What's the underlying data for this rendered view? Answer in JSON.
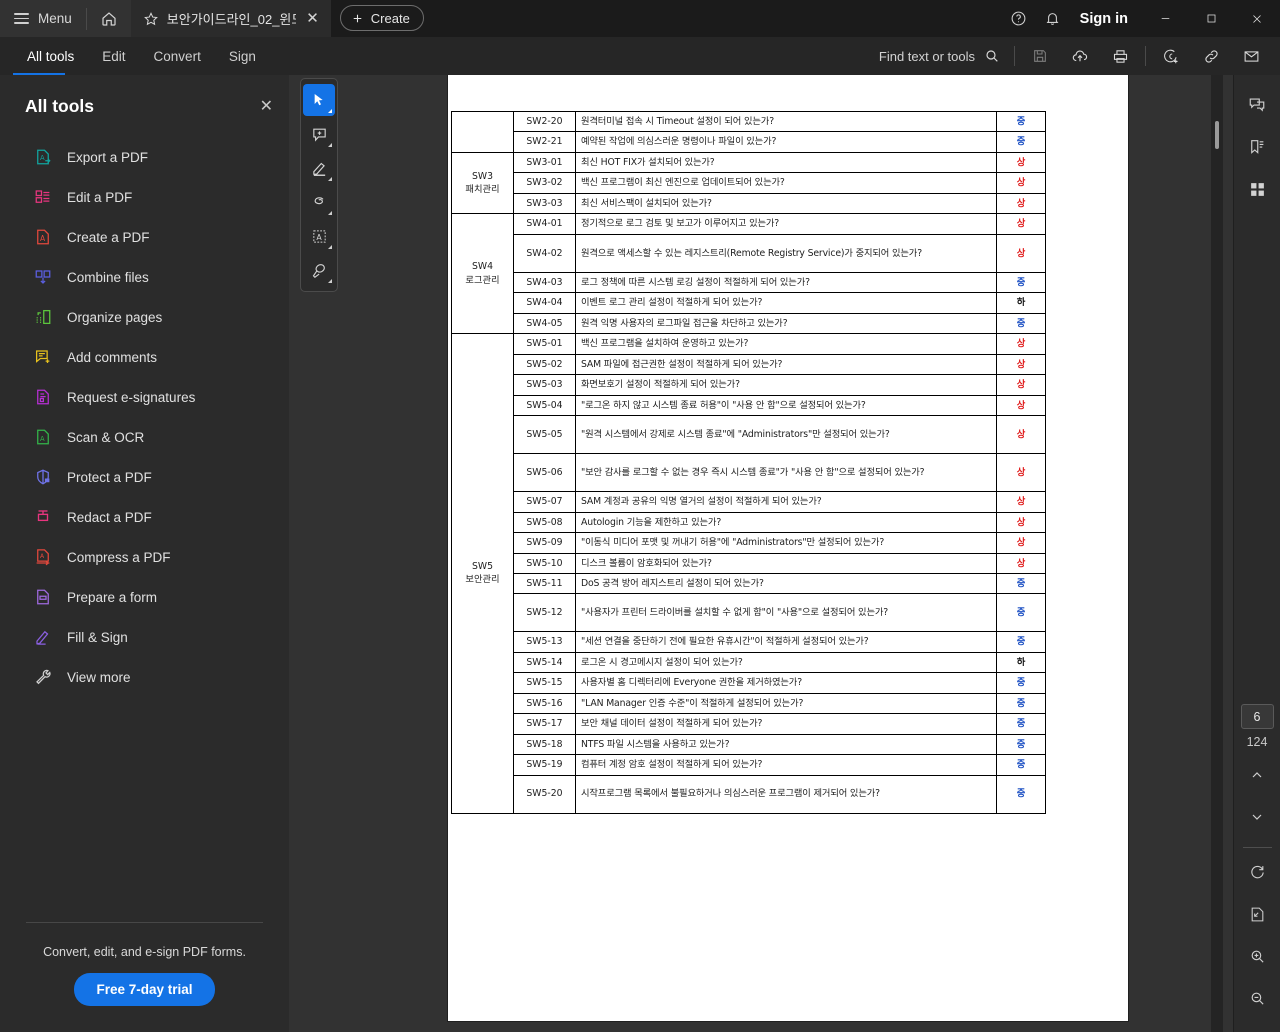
{
  "titlebar": {
    "menu_label": "Menu",
    "home_icon": "home-icon",
    "tab_title": "보안가이드라인_02_윈도…",
    "tab_close": "✕",
    "create_label": "Create",
    "help_icon": "help-icon",
    "bell_icon": "bell-icon",
    "signin_label": "Sign in",
    "minimize": "—",
    "maximize": "▫",
    "close": "✕"
  },
  "menubar": {
    "items": [
      {
        "label": "All tools",
        "active": true
      },
      {
        "label": "Edit",
        "active": false
      },
      {
        "label": "Convert",
        "active": false
      },
      {
        "label": "Sign",
        "active": false
      }
    ],
    "find_label": "Find text or tools",
    "icons": [
      "search-icon",
      "save-icon",
      "cloud-upload-icon",
      "print-icon",
      "add-stamp-icon",
      "link-icon",
      "mail-icon"
    ]
  },
  "sidebar": {
    "title": "All tools",
    "close_label": "✕",
    "items": [
      {
        "label": "Export a PDF",
        "icon": "export-pdf-icon",
        "color": "#12a5a0"
      },
      {
        "label": "Edit a PDF",
        "icon": "edit-pdf-icon",
        "color": "#e8357f"
      },
      {
        "label": "Create a PDF",
        "icon": "create-pdf-icon",
        "color": "#e3483c"
      },
      {
        "label": "Combine files",
        "icon": "combine-files-icon",
        "color": "#5b5fe0"
      },
      {
        "label": "Organize pages",
        "icon": "organize-pages-icon",
        "color": "#5cc63d"
      },
      {
        "label": "Add comments",
        "icon": "add-comments-icon",
        "color": "#e8c21d"
      },
      {
        "label": "Request e-signatures",
        "icon": "request-esign-icon",
        "color": "#c councils"
      },
      {
        "label": "Scan & OCR",
        "icon": "scan-ocr-icon",
        "color": "#33b54a"
      },
      {
        "label": "Protect a PDF",
        "icon": "protect-pdf-icon",
        "color": "#6f73e8"
      },
      {
        "label": "Redact a PDF",
        "icon": "redact-pdf-icon",
        "color": "#e8357f"
      },
      {
        "label": "Compress a PDF",
        "icon": "compress-pdf-icon",
        "color": "#e3483c"
      },
      {
        "label": "Prepare a form",
        "icon": "prepare-form-icon",
        "color": "#a06ae0"
      },
      {
        "label": "Fill & Sign",
        "icon": "fill-sign-icon",
        "color": "#8a5fe0"
      },
      {
        "label": "View more",
        "icon": "view-more-icon",
        "color": "#c9c9c9"
      }
    ],
    "promo_text": "Convert, edit, and e-sign PDF forms.",
    "trial_button": "Free 7-day trial"
  },
  "doc_toolbar": {
    "items": [
      {
        "icon": "select-cursor-icon",
        "selected": true
      },
      {
        "icon": "add-comment-icon",
        "selected": false
      },
      {
        "icon": "highlight-icon",
        "selected": false
      },
      {
        "icon": "draw-freehand-icon",
        "selected": false
      },
      {
        "icon": "text-edit-icon",
        "selected": false
      },
      {
        "icon": "stamp-icon",
        "selected": false
      }
    ]
  },
  "right_rail": {
    "top_icons": [
      "comment-panel-icon",
      "bookmark-panel-icon",
      "thumbnail-panel-icon"
    ],
    "current_page": "6",
    "total_pages": "124",
    "prev_icon": "chevron-up-icon",
    "next_icon": "chevron-down-icon",
    "bottom_icons": [
      "rotate-icon",
      "fit-page-icon",
      "zoom-in-icon",
      "zoom-out-icon"
    ]
  },
  "document": {
    "rows": [
      {
        "category": "",
        "code": "SW2-20",
        "desc": "원격터미널 접속 시 Timeout 설정이 되어 있는가?",
        "level": "중",
        "level_class": "mid",
        "cat_rowspan": 0,
        "lines": 1
      },
      {
        "category": "",
        "code": "SW2-21",
        "desc": "예약된 작업에 의심스러운 명령이나 파일이 있는가?",
        "level": "중",
        "level_class": "mid",
        "cat_rowspan": 0,
        "lines": 1
      },
      {
        "category": "SW3\n패치관리",
        "code": "SW3-01",
        "desc": "최신 HOT FIX가 설치되어 있는가?",
        "level": "상",
        "level_class": "high",
        "cat_rowspan": 3,
        "lines": 1
      },
      {
        "category": "",
        "code": "SW3-02",
        "desc": "백신 프로그램이 최신 엔진으로 업데이트되어 있는가?",
        "level": "상",
        "level_class": "high",
        "cat_rowspan": 0,
        "lines": 1
      },
      {
        "category": "",
        "code": "SW3-03",
        "desc": "최신 서비스팩이 설치되어 있는가?",
        "level": "상",
        "level_class": "high",
        "cat_rowspan": 0,
        "lines": 1
      },
      {
        "category": "SW4\n로그관리",
        "code": "SW4-01",
        "desc": "정기적으로 로그 검토 및 보고가 이루어지고 있는가?",
        "level": "상",
        "level_class": "high",
        "cat_rowspan": 5,
        "lines": 1
      },
      {
        "category": "",
        "code": "SW4-02",
        "desc": "원격으로 액세스할 수 있는 레지스트리(Remote Registry Service)가 중지되어 있는가?",
        "level": "상",
        "level_class": "high",
        "cat_rowspan": 0,
        "lines": 2
      },
      {
        "category": "",
        "code": "SW4-03",
        "desc": "로그 정책에 따른 시스템 로깅 설정이 적절하게 되어 있는가?",
        "level": "중",
        "level_class": "mid",
        "cat_rowspan": 0,
        "lines": 1
      },
      {
        "category": "",
        "code": "SW4-04",
        "desc": "이벤트 로그 관리 설정이 적절하게 되어 있는가?",
        "level": "하",
        "level_class": "low",
        "cat_rowspan": 0,
        "lines": 1
      },
      {
        "category": "",
        "code": "SW4-05",
        "desc": "원격 익명 사용자의 로그파일 접근을 차단하고 있는가?",
        "level": "중",
        "level_class": "mid",
        "cat_rowspan": 0,
        "lines": 1
      },
      {
        "category": "SW5\n보안관리",
        "code": "SW5-01",
        "desc": "백신 프로그램을 설치하여 운영하고 있는가?",
        "level": "상",
        "level_class": "high",
        "cat_rowspan": 20,
        "lines": 1
      },
      {
        "category": "",
        "code": "SW5-02",
        "desc": "SAM 파일에 접근권한 설정이 적절하게 되어 있는가?",
        "level": "상",
        "level_class": "high",
        "cat_rowspan": 0,
        "lines": 1
      },
      {
        "category": "",
        "code": "SW5-03",
        "desc": "화면보호기 설정이 적절하게 되어 있는가?",
        "level": "상",
        "level_class": "high",
        "cat_rowspan": 0,
        "lines": 1
      },
      {
        "category": "",
        "code": "SW5-04",
        "desc": "\"로그온 하지 않고 시스템 종료 허용\"이 \"사용 안 함\"으로 설정되어 있는가?",
        "level": "상",
        "level_class": "high",
        "cat_rowspan": 0,
        "lines": 1
      },
      {
        "category": "",
        "code": "SW5-05",
        "desc": "\"원격 시스템에서 강제로 시스템 종료\"에 \"Administrators\"만 설정되어 있는가?",
        "level": "상",
        "level_class": "high",
        "cat_rowspan": 0,
        "lines": 2
      },
      {
        "category": "",
        "code": "SW5-06",
        "desc": "\"보안 감사를 로그할 수 없는 경우 즉시 시스템 종료\"가 \"사용 안 함\"으로 설정되어 있는가?",
        "level": "상",
        "level_class": "high",
        "cat_rowspan": 0,
        "lines": 2
      },
      {
        "category": "",
        "code": "SW5-07",
        "desc": "SAM 계정과 공유의 익명 열거의 설정이 적절하게 되어 있는가?",
        "level": "상",
        "level_class": "high",
        "cat_rowspan": 0,
        "lines": 1
      },
      {
        "category": "",
        "code": "SW5-08",
        "desc": "Autologin 기능을 제한하고 있는가?",
        "level": "상",
        "level_class": "high",
        "cat_rowspan": 0,
        "lines": 1
      },
      {
        "category": "",
        "code": "SW5-09",
        "desc": "\"이동식 미디어 포맷 및 꺼내기 허용\"에 \"Administrators\"만 설정되어 있는가?",
        "level": "상",
        "level_class": "high",
        "cat_rowspan": 0,
        "lines": 1
      },
      {
        "category": "",
        "code": "SW5-10",
        "desc": "디스크 볼륨이 암호화되어 있는가?",
        "level": "상",
        "level_class": "high",
        "cat_rowspan": 0,
        "lines": 1
      },
      {
        "category": "",
        "code": "SW5-11",
        "desc": "DoS 공격 방어 레지스트리 설정이 되어 있는가?",
        "level": "중",
        "level_class": "mid",
        "cat_rowspan": 0,
        "lines": 1
      },
      {
        "category": "",
        "code": "SW5-12",
        "desc": "\"사용자가 프린터 드라이버를 설치할 수 없게 함\"이 \"사용\"으로 설정되어 있는가?",
        "level": "중",
        "level_class": "mid",
        "cat_rowspan": 0,
        "lines": 2
      },
      {
        "category": "",
        "code": "SW5-13",
        "desc": "\"세션 연결을 중단하기 전에 필요한 유휴시간\"이 적절하게 설정되어 있는가?",
        "level": "중",
        "level_class": "mid",
        "cat_rowspan": 0,
        "lines": 1
      },
      {
        "category": "",
        "code": "SW5-14",
        "desc": "로그온 시 경고메시지 설정이 되어 있는가?",
        "level": "하",
        "level_class": "low",
        "cat_rowspan": 0,
        "lines": 1
      },
      {
        "category": "",
        "code": "SW5-15",
        "desc": "사용자별 홈 디렉터리에 Everyone 권한을 제거하였는가?",
        "level": "중",
        "level_class": "mid",
        "cat_rowspan": 0,
        "lines": 1
      },
      {
        "category": "",
        "code": "SW5-16",
        "desc": "\"LAN Manager 인증 수준\"이 적절하게 설정되어 있는가?",
        "level": "중",
        "level_class": "mid",
        "cat_rowspan": 0,
        "lines": 1
      },
      {
        "category": "",
        "code": "SW5-17",
        "desc": "보안 채널 데이터 설정이 적절하게 되어 있는가?",
        "level": "중",
        "level_class": "mid",
        "cat_rowspan": 0,
        "lines": 1
      },
      {
        "category": "",
        "code": "SW5-18",
        "desc": "NTFS 파일 시스템을 사용하고 있는가?",
        "level": "중",
        "level_class": "mid",
        "cat_rowspan": 0,
        "lines": 1
      },
      {
        "category": "",
        "code": "SW5-19",
        "desc": "컴퓨터 계정 암호 설정이 적절하게 되어 있는가?",
        "level": "중",
        "level_class": "mid",
        "cat_rowspan": 0,
        "lines": 1
      },
      {
        "category": "",
        "code": "SW5-20",
        "desc": "시작프로그램 목록에서 불필요하거나 의심스러운 프로그램이 제거되어 있는가?",
        "level": "중",
        "level_class": "mid",
        "cat_rowspan": 0,
        "lines": 2
      }
    ]
  }
}
